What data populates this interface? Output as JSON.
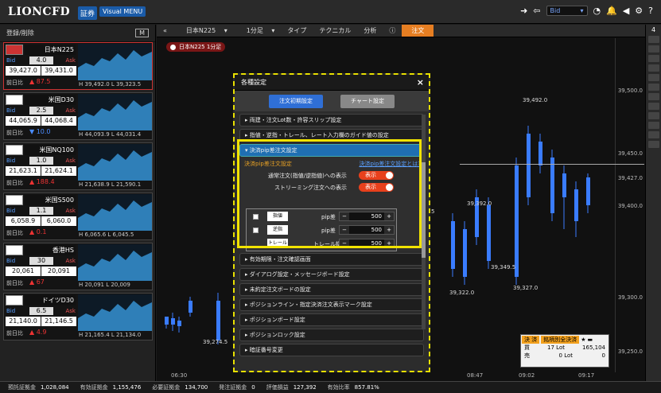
{
  "brand": {
    "logo": "LIONCFD",
    "sec_badge": "証券",
    "visual_menu": "Visual MENU"
  },
  "top": {
    "bid_select": "Bid"
  },
  "left": {
    "register": "登録/削除",
    "tiles": [
      {
        "name": "日本N225",
        "spread": "4.0",
        "bid": "39,427.0",
        "ask": "39,431.0",
        "prev_label": "前日比",
        "change": "87.5",
        "dir": "up",
        "hl": "H 39,492.0  L 39,323.5",
        "color": "#c33",
        "selected": true
      },
      {
        "name": "米国D30",
        "spread": "2.5",
        "bid": "44,065.9",
        "ask": "44,068.4",
        "prev_label": "前日比",
        "change": "10.0",
        "dir": "dn",
        "hl": "H 44,093.9  L 44,031.4",
        "color": "#fff",
        "selected": false
      },
      {
        "name": "米国NQ100",
        "spread": "1.0",
        "bid": "21,623.1",
        "ask": "21,624.1",
        "prev_label": "前日比",
        "change": "188.4",
        "dir": "up",
        "hl": "H 21,638.9  L 21,590.1",
        "color": "#fff",
        "selected": false
      },
      {
        "name": "米国S500",
        "spread": "1.1",
        "bid": "6,058.9",
        "ask": "6,060.0",
        "prev_label": "前日比",
        "change": "0.1",
        "dir": "up",
        "hl": "H 6,065.6  L 6,045.5",
        "color": "#fff",
        "selected": false
      },
      {
        "name": "香港HS",
        "spread": "30",
        "bid": "20,061",
        "ask": "20,091",
        "prev_label": "前日比",
        "change": "67",
        "dir": "up",
        "hl": "H 20,091  L 20,009",
        "color": "#fff",
        "selected": false
      },
      {
        "name": "ドイツD30",
        "spread": "6.5",
        "bid": "21,140.0",
        "ask": "21,146.5",
        "prev_label": "前日比",
        "change": "4.9",
        "dir": "up",
        "hl": "H 21,165.4  L 21,134.0",
        "color": "#fff",
        "selected": false
      }
    ]
  },
  "chart": {
    "symbol": "日本N225",
    "interval": "1分足",
    "type": "タイプ",
    "technical": "テクニカル",
    "analysis": "分析",
    "order": "注文",
    "sublabel": "日本N225 1分足",
    "yticks": [
      "39,500.0",
      "39,450.0",
      "39,427.0",
      "39,400.0",
      "39,350.0",
      "39,300.0",
      "39,250.0"
    ],
    "xticks": [
      "06:30",
      "08:47",
      "09:02",
      "09:17"
    ],
    "annot": [
      "39,492.0",
      "39,392.0",
      "39,349.5",
      "39,322.0",
      "39,327.0",
      "39,274.5",
      "5"
    ]
  },
  "dialog": {
    "title": "各種設定",
    "tab_on": "注文初期設定",
    "tab_off": "チャート設定",
    "sections": [
      "両建・注文Lot数・許容スリップ設定",
      "指値・逆指・トレール、レート入力欄のガイド値の設定",
      "決済pip差注文設定",
      "有効期限・注文確認画面",
      "ダイアログ設定・メッセージボード設定",
      "未約定注文ボードの設定",
      "ポジションライン・指定決済注文表示マーク設定",
      "ポジションボード設定",
      "ポジションロック設定",
      "暗証番号変更"
    ],
    "body_title": "決済pip差注文設定",
    "body_link": "決済pip差注文設定とは?",
    "row1": "通常注文(指値/逆指値)への表示",
    "row2": "ストリーミング注文への表示",
    "toggle": "表示",
    "orders": [
      {
        "label": "指値",
        "unit": "pip差",
        "value": "500"
      },
      {
        "label": "逆指",
        "unit": "pip差",
        "value": "500"
      },
      {
        "label": "トレール",
        "unit": "トレール幅",
        "value": "500"
      }
    ]
  },
  "position": {
    "close": "決 済",
    "by_symbol": "銘柄別全決済",
    "buy": "買",
    "sell": "売",
    "buy_lot": "17 Lot",
    "sell_lot": "0 Lot",
    "buy_val": "165,104",
    "sell_val": "0"
  },
  "status": [
    [
      "預託証拠金",
      "1,028,084"
    ],
    [
      "有効証拠金",
      "1,155,476"
    ],
    [
      "必要証拠金",
      "134,700"
    ],
    [
      "発注証拠金",
      "0"
    ],
    [
      "評価損益",
      "127,392"
    ],
    [
      "有効比率",
      "857.81%"
    ]
  ]
}
